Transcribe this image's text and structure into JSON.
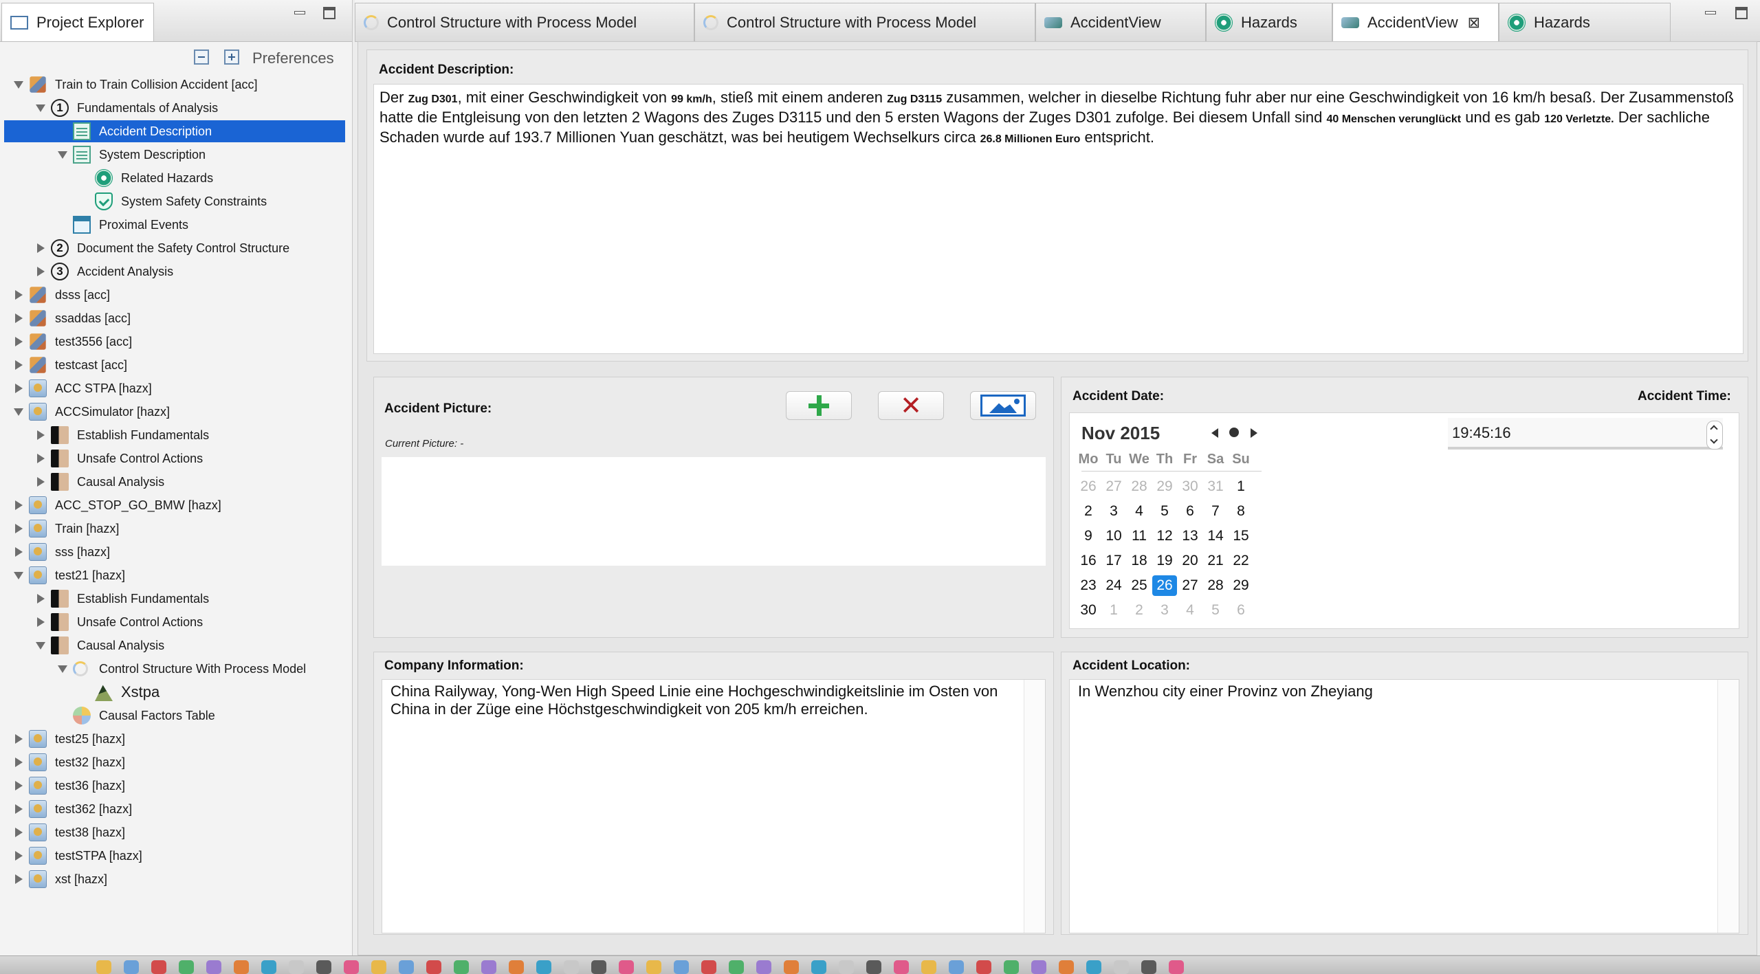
{
  "left_panel": {
    "tab_title": "Project Explorer",
    "toolbar": {
      "preferences_label": "Preferences"
    }
  },
  "tree": [
    {
      "label": "Train to Train Collision Accident [acc]",
      "depth": 0,
      "expander": "open",
      "icon": "accident-project-icon"
    },
    {
      "label": "Fundamentals of Analysis",
      "depth": 1,
      "expander": "open",
      "icon": "step-number-icon",
      "number": "1"
    },
    {
      "label": "Accident Description",
      "depth": 2,
      "expander": "none",
      "icon": "accident-description-icon",
      "selected": true
    },
    {
      "label": "System Description",
      "depth": 2,
      "expander": "open",
      "icon": "system-description-icon"
    },
    {
      "label": "Related Hazards",
      "depth": 3,
      "expander": "none",
      "icon": "hazard-icon"
    },
    {
      "label": "System Safety Constraints",
      "depth": 3,
      "expander": "none",
      "icon": "safety-shield-icon"
    },
    {
      "label": "Proximal Events",
      "depth": 2,
      "expander": "none",
      "icon": "calendar-icon"
    },
    {
      "label": "Document the Safety Control Structure",
      "depth": 1,
      "expander": "closed",
      "icon": "step-number-icon",
      "number": "2"
    },
    {
      "label": "Accident Analysis",
      "depth": 1,
      "expander": "closed",
      "icon": "step-number-icon",
      "number": "3"
    },
    {
      "label": "dsss [acc]",
      "depth": 0,
      "expander": "closed",
      "icon": "accident-project-icon"
    },
    {
      "label": "ssaddas [acc]",
      "depth": 0,
      "expander": "closed",
      "icon": "accident-project-icon"
    },
    {
      "label": "test3556 [acc]",
      "depth": 0,
      "expander": "closed",
      "icon": "accident-project-icon"
    },
    {
      "label": "testcast [acc]",
      "depth": 0,
      "expander": "closed",
      "icon": "accident-project-icon"
    },
    {
      "label": "ACC STPA [hazx]",
      "depth": 0,
      "expander": "closed",
      "icon": "hazx-project-icon"
    },
    {
      "label": "ACCSimulator [hazx]",
      "depth": 0,
      "expander": "open",
      "icon": "hazx-project-icon"
    },
    {
      "label": "Establish Fundamentals",
      "depth": 1,
      "expander": "closed",
      "icon": "step-0-icon"
    },
    {
      "label": "Unsafe Control Actions",
      "depth": 1,
      "expander": "closed",
      "icon": "step-1-icon"
    },
    {
      "label": "Causal Analysis",
      "depth": 1,
      "expander": "closed",
      "icon": "step-2-icon"
    },
    {
      "label": "ACC_STOP_GO_BMW [hazx]",
      "depth": 0,
      "expander": "closed",
      "icon": "hazx-project-icon"
    },
    {
      "label": "Train [hazx]",
      "depth": 0,
      "expander": "closed",
      "icon": "hazx-project-icon"
    },
    {
      "label": "sss [hazx]",
      "depth": 0,
      "expander": "closed",
      "icon": "hazx-project-icon"
    },
    {
      "label": "test21 [hazx]",
      "depth": 0,
      "expander": "open",
      "icon": "hazx-project-icon"
    },
    {
      "label": "Establish Fundamentals",
      "depth": 1,
      "expander": "closed",
      "icon": "step-0-icon"
    },
    {
      "label": "Unsafe Control Actions",
      "depth": 1,
      "expander": "closed",
      "icon": "step-1-icon"
    },
    {
      "label": "Causal Analysis",
      "depth": 1,
      "expander": "open",
      "icon": "step-2-icon"
    },
    {
      "label": "Control Structure With Process Model",
      "depth": 2,
      "expander": "open",
      "icon": "control-structure-icon"
    },
    {
      "label": "Xstpa",
      "depth": 3,
      "expander": "none",
      "icon": "xstpa-icon",
      "large": true
    },
    {
      "label": "Causal Factors Table",
      "depth": 2,
      "expander": "none",
      "icon": "causal-factors-icon"
    },
    {
      "label": "test25 [hazx]",
      "depth": 0,
      "expander": "closed",
      "icon": "hazx-project-icon"
    },
    {
      "label": "test32 [hazx]",
      "depth": 0,
      "expander": "closed",
      "icon": "hazx-project-icon"
    },
    {
      "label": "test36 [hazx]",
      "depth": 0,
      "expander": "closed",
      "icon": "hazx-project-icon"
    },
    {
      "label": "test362 [hazx]",
      "depth": 0,
      "expander": "closed",
      "icon": "hazx-project-icon"
    },
    {
      "label": "test38 [hazx]",
      "depth": 0,
      "expander": "closed",
      "icon": "hazx-project-icon"
    },
    {
      "label": "testSTPA [hazx]",
      "depth": 0,
      "expander": "closed",
      "icon": "hazx-project-icon"
    },
    {
      "label": "xst [hazx]",
      "depth": 0,
      "expander": "closed",
      "icon": "hazx-project-icon"
    }
  ],
  "editor_tabs": [
    {
      "label": "Control Structure with Process Model",
      "icon": "control-structure-icon"
    },
    {
      "label": "Control Structure with Process Model",
      "icon": "control-structure-icon"
    },
    {
      "label": "AccidentView",
      "icon": "accident-view-icon"
    },
    {
      "label": "Hazards",
      "icon": "hazard-icon"
    },
    {
      "label": "AccidentView",
      "icon": "accident-view-icon",
      "active": true,
      "closable": true
    },
    {
      "label": "Hazards",
      "icon": "hazard-icon"
    }
  ],
  "accident_description": {
    "label": "Accident Description:",
    "text_segments": [
      {
        "t": "Der "
      },
      {
        "t": "Zug D301",
        "b": true
      },
      {
        "t": ", mit einer Geschwindigkeit von "
      },
      {
        "t": "99 km/h",
        "b": true
      },
      {
        "t": ", stieß mit einem anderen "
      },
      {
        "t": "Zug D3115",
        "b": true
      },
      {
        "t": " zusammen, welcher in dieselbe Richtung fuhr aber nur eine Geschwindigkeit von 16 km/h besaß. Der Zusammenstoß hatte die Entgleisung von den letzten 2 Wagons des Zuges D3115 und den 5 ersten Wagons der Zuges D301 zufolge. Bei diesem Unfall sind "
      },
      {
        "t": "40 Menschen verunglückt",
        "b": true
      },
      {
        "t": " und es gab "
      },
      {
        "t": "120 Verletzte.",
        "b": true
      },
      {
        "t": " Der sachliche Schaden wurde auf 193.7 Millionen Yuan geschätzt, was bei heutigem Wechselkurs circa "
      },
      {
        "t": "26.8 Millionen Euro",
        "b": true
      },
      {
        "t": " entspricht."
      }
    ]
  },
  "accident_picture": {
    "label": "Accident Picture:",
    "current_label": "Current Picture: -",
    "buttons": [
      "add-picture-button",
      "remove-picture-button",
      "view-picture-button"
    ]
  },
  "accident_date": {
    "label": "Accident Date:",
    "month_year": "Nov 2015",
    "weekdays": [
      "Mo",
      "Tu",
      "We",
      "Th",
      "Fr",
      "Sa",
      "Su"
    ],
    "weeks": [
      [
        [
          "26",
          1
        ],
        [
          "27",
          1
        ],
        [
          "28",
          1
        ],
        [
          "29",
          1
        ],
        [
          "30",
          1
        ],
        [
          "31",
          1
        ],
        [
          "1",
          0
        ]
      ],
      [
        [
          "2",
          0
        ],
        [
          "3",
          0
        ],
        [
          "4",
          0
        ],
        [
          "5",
          0
        ],
        [
          "6",
          0
        ],
        [
          "7",
          0
        ],
        [
          "8",
          0
        ]
      ],
      [
        [
          "9",
          0
        ],
        [
          "10",
          0
        ],
        [
          "11",
          0
        ],
        [
          "12",
          0
        ],
        [
          "13",
          0
        ],
        [
          "14",
          0
        ],
        [
          "15",
          0
        ]
      ],
      [
        [
          "16",
          0
        ],
        [
          "17",
          0
        ],
        [
          "18",
          0
        ],
        [
          "19",
          0
        ],
        [
          "20",
          0
        ],
        [
          "21",
          0
        ],
        [
          "22",
          0
        ]
      ],
      [
        [
          "23",
          0
        ],
        [
          "24",
          0
        ],
        [
          "25",
          0
        ],
        [
          "26",
          2
        ],
        [
          "27",
          0
        ],
        [
          "28",
          0
        ],
        [
          "29",
          0
        ]
      ],
      [
        [
          "30",
          0
        ],
        [
          "1",
          1
        ],
        [
          "2",
          1
        ],
        [
          "3",
          1
        ],
        [
          "4",
          1
        ],
        [
          "5",
          1
        ],
        [
          "6",
          1
        ]
      ]
    ]
  },
  "accident_time": {
    "label": "Accident Time:",
    "value": "19:45:16"
  },
  "company_information": {
    "label": "Company Information:",
    "text": "China Railyway, Yong-Wen High Speed Linie eine Hochgeschwindigkeitslinie im Osten von China in der Züge eine Höchstgeschwindigkeit von 205 km/h erreichen."
  },
  "accident_location": {
    "label": "Accident Location:",
    "text": "In Wenzhou city einer Provinz von Zheyiang"
  },
  "colors": {
    "selection": "#1a64d4",
    "calendar_selected": "#1e88e5",
    "accent_green": "#1f9e7a"
  }
}
